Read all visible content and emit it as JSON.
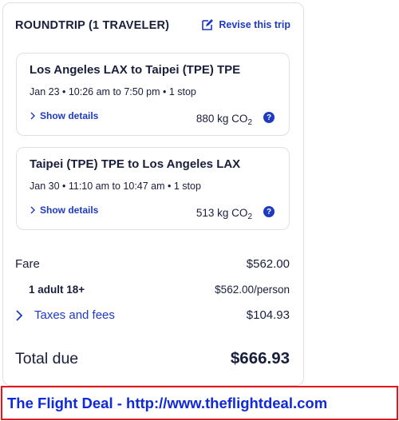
{
  "header": {
    "title": "ROUNDTRIP (1 TRAVELER)",
    "revise_label": "Revise this trip"
  },
  "legs": [
    {
      "route": "Los Angeles LAX to Taipei (TPE) TPE",
      "times": "Jan 23 • 10:26 am to 7:50 pm • 1 stop",
      "show_details": "Show details",
      "co2_value": "880 kg CO",
      "co2_sub": "2",
      "help": "?"
    },
    {
      "route": "Taipei (TPE) TPE to Los Angeles LAX",
      "times": "Jan 30 • 11:10 am to 10:47 am • 1 stop",
      "show_details": "Show details",
      "co2_value": "513 kg CO",
      "co2_sub": "2",
      "help": "?"
    }
  ],
  "price": {
    "fare_label": "Fare",
    "fare_value": "$562.00",
    "adult_label": "1 adult 18+",
    "adult_value": "$562.00/person",
    "taxes_label": "Taxes and fees",
    "taxes_value": "$104.93",
    "total_label": "Total due",
    "total_value": "$666.93"
  },
  "banner": {
    "text": "The Flight Deal - http://www.theflightdeal.com"
  },
  "colors": {
    "link": "#1d3ac1",
    "text": "#191e3b",
    "banner_border": "#e8141a",
    "banner_text": "#0f2ad6"
  }
}
